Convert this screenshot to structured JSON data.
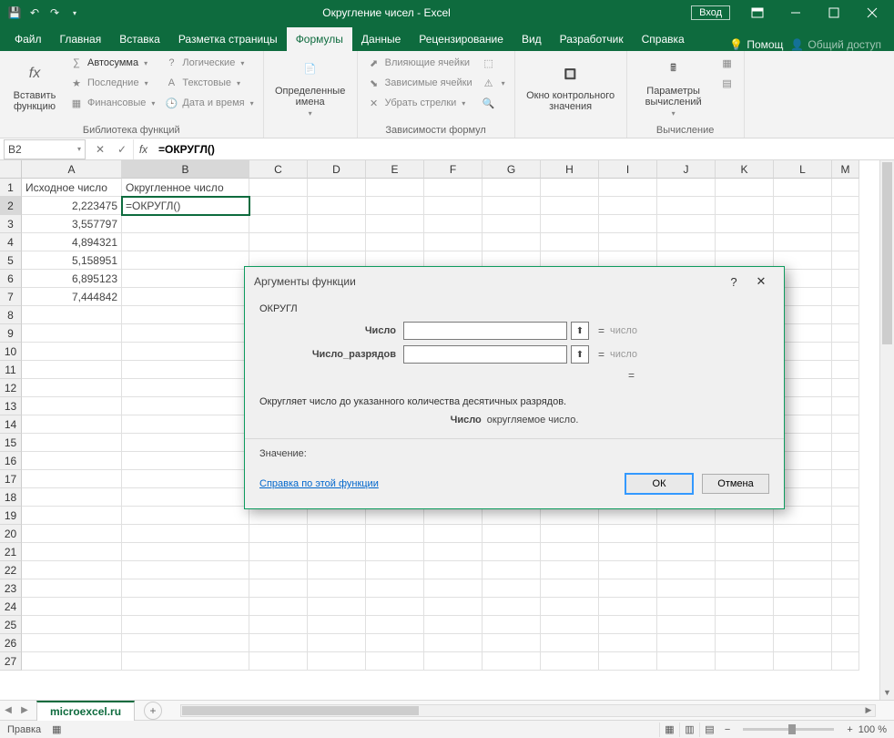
{
  "titlebar": {
    "title": "Округление чисел - Excel",
    "login": "Вход"
  },
  "ribbon": {
    "tabs": [
      "Файл",
      "Главная",
      "Вставка",
      "Разметка страницы",
      "Формулы",
      "Данные",
      "Рецензирование",
      "Вид",
      "Разработчик",
      "Справка"
    ],
    "active_index": 4,
    "help_label": "Помощ",
    "share_label": "Общий доступ"
  },
  "ribbon_groups": {
    "insert_fn": "Вставить функцию",
    "autosum": "Автосумма",
    "recent": "Последние",
    "financial": "Финансовые",
    "logical": "Логические",
    "text": "Текстовые",
    "datetime": "Дата и время",
    "library_label": "Библиотека функций",
    "defined_names": "Определенные имена",
    "trace_precedents": "Влияющие ячейки",
    "trace_dependents": "Зависимые ячейки",
    "remove_arrows": "Убрать стрелки",
    "watch_window": "Окно контрольного значения",
    "calc_options": "Параметры вычислений",
    "deps_label": "Зависимости формул",
    "calc_label": "Вычисление"
  },
  "namebox": "B2",
  "formula": "=ОКРУГЛ()",
  "columns": [
    {
      "l": "A",
      "w": 110
    },
    {
      "l": "B",
      "w": 140
    },
    {
      "l": "C",
      "w": 64
    },
    {
      "l": "D",
      "w": 64
    },
    {
      "l": "E",
      "w": 64
    },
    {
      "l": "F",
      "w": 64
    },
    {
      "l": "G",
      "w": 64
    },
    {
      "l": "H",
      "w": 64
    },
    {
      "l": "I",
      "w": 64
    },
    {
      "l": "J",
      "w": 64
    },
    {
      "l": "K",
      "w": 64
    },
    {
      "l": "L",
      "w": 64
    },
    {
      "l": "M",
      "w": 30
    }
  ],
  "header_row": {
    "A": "Исходное число",
    "B": "Округленное число"
  },
  "data_rows": [
    {
      "A": "2,223475",
      "B": "=ОКРУГЛ()"
    },
    {
      "A": "3,557797",
      "B": ""
    },
    {
      "A": "4,894321",
      "B": ""
    },
    {
      "A": "5,158951",
      "B": ""
    },
    {
      "A": "6,895123",
      "B": ""
    },
    {
      "A": "7,444842",
      "B": ""
    }
  ],
  "row_count": 27,
  "sheet_name": "microexcel.ru",
  "status": {
    "mode": "Правка",
    "zoom": "100 %"
  },
  "dialog": {
    "title": "Аргументы функции",
    "func_name": "ОКРУГЛ",
    "arg1_label": "Число",
    "arg2_label": "Число_разрядов",
    "placeholder": "число",
    "desc": "Округляет число до указанного количества десятичных разрядов.",
    "arg_name": "Число",
    "arg_desc": "округляемое число.",
    "value_label": "Значение:",
    "help_link": "Справка по этой функции",
    "ok": "ОК",
    "cancel": "Отмена"
  }
}
